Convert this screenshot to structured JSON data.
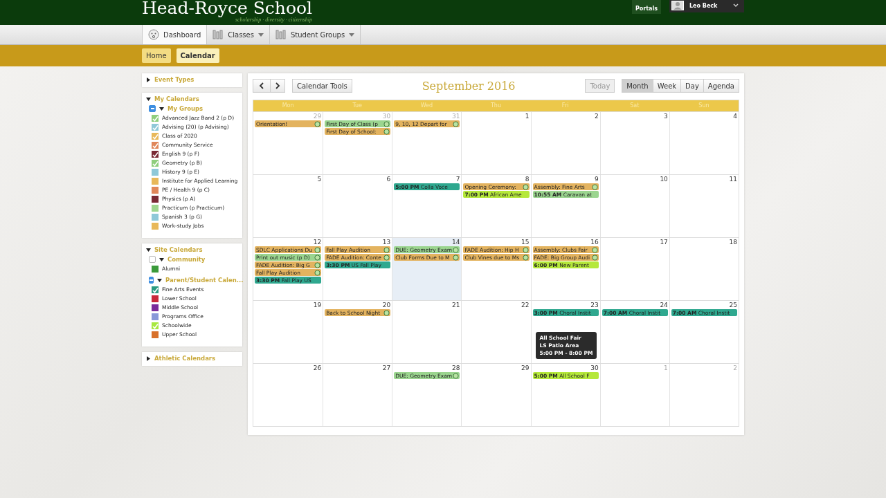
{
  "header": {
    "logo": "Head-Royce School",
    "tagline": "scholarship · diversity · citizenship",
    "portals": "Portals",
    "user": "Leo Beck"
  },
  "nav": [
    {
      "label": "Dashboard",
      "kind": "dashboard",
      "selected": true,
      "menu": false
    },
    {
      "label": "Classes",
      "kind": "list",
      "selected": false,
      "menu": true
    },
    {
      "label": "Student Groups",
      "kind": "list",
      "selected": false,
      "menu": true
    }
  ],
  "breadcrumbs": [
    {
      "label": "Home",
      "selected": false
    },
    {
      "label": "Calendar",
      "selected": true
    }
  ],
  "sidebar": [
    {
      "title": "Event Types",
      "expanded": false
    },
    {
      "title": "My Calendars",
      "expanded": true,
      "groups": [
        {
          "title": "My Groups",
          "checked": true,
          "expanded": true,
          "items": [
            {
              "label": "Advanced Jazz Band 2 (p D)",
              "color": "#8fce7d",
              "checked": true
            },
            {
              "label": "Advising (20) (p Advising)",
              "color": "#8fc8d8",
              "checked": true
            },
            {
              "label": "Class of 2020",
              "color": "#e8b85a",
              "checked": true
            },
            {
              "label": "Community Service",
              "color": "#e0875a",
              "checked": true
            },
            {
              "label": "English 9 (p F)",
              "color": "#7a2a35",
              "checked": true
            },
            {
              "label": "Geometry (p B)",
              "color": "#8fce7d",
              "checked": true
            },
            {
              "label": "History 9 (p E)",
              "color": "#8fc8d8",
              "checked": false
            },
            {
              "label": "Institute for Applied Learning",
              "color": "#e8b85a",
              "checked": false
            },
            {
              "label": "PE / Health 9 (p C)",
              "color": "#e0875a",
              "checked": false
            },
            {
              "label": "Physics (p A)",
              "color": "#7a2a35",
              "checked": false
            },
            {
              "label": "Practicum (p Practicum)",
              "color": "#9fd68f",
              "checked": false
            },
            {
              "label": "Spanish 3 (p G)",
              "color": "#8fc8d8",
              "checked": false
            },
            {
              "label": "Work-study Jobs",
              "color": "#e8b85a",
              "checked": false
            }
          ]
        }
      ]
    },
    {
      "title": "Site Calendars",
      "expanded": true,
      "groups": [
        {
          "title": "Community",
          "checked": false,
          "expanded": true,
          "items": [
            {
              "label": "Alumni",
              "color": "#3a9a3a",
              "checked": false
            }
          ]
        },
        {
          "title": "Parent/Student Calen...",
          "checked": true,
          "expanded": true,
          "items": [
            {
              "label": "Fine Arts Events",
              "color": "#2a9a80",
              "checked": true
            },
            {
              "label": "Lower School",
              "color": "#c8283a",
              "checked": false
            },
            {
              "label": "Middle School",
              "color": "#7a2a9a",
              "checked": false
            },
            {
              "label": "Programs Office",
              "color": "#8898d8",
              "checked": false
            },
            {
              "label": "Schoolwide",
              "color": "#a8e840",
              "checked": true
            },
            {
              "label": "Upper School",
              "color": "#d8702a",
              "checked": false
            }
          ]
        }
      ]
    },
    {
      "title": "Athletic Calendars",
      "expanded": false
    }
  ],
  "calendar": {
    "tools": "Calendar Tools",
    "title": "September 2016",
    "today": {
      "label": "Today",
      "disabled": true
    },
    "views": [
      {
        "label": "Month",
        "selected": true
      },
      {
        "label": "Week",
        "selected": false
      },
      {
        "label": "Day",
        "selected": false
      },
      {
        "label": "Agenda",
        "selected": false
      }
    ],
    "weekdays": [
      "Mon",
      "Tue",
      "Wed",
      "Thu",
      "Fri",
      "Sat",
      "Sun"
    ],
    "weeks": [
      [
        {
          "day": "29",
          "other_month": true,
          "today": false,
          "events": [
            {
              "title": "Orientation!",
              "color": "#e3b35f"
            }
          ]
        },
        {
          "day": "30",
          "other_month": true,
          "today": false,
          "events": [
            {
              "title": "First Day of Class (p",
              "color": "#9bd58f"
            },
            {
              "title": "First Day of School:",
              "color": "#e3b35f"
            }
          ]
        },
        {
          "day": "31",
          "other_month": true,
          "today": false,
          "events": [
            {
              "title": "9, 10, 12 Depart for",
              "color": "#e3b35f"
            }
          ]
        },
        {
          "day": "1",
          "other_month": false,
          "today": false
        },
        {
          "day": "2",
          "other_month": false,
          "today": false
        },
        {
          "day": "3",
          "other_month": false,
          "today": false
        },
        {
          "day": "4",
          "other_month": false,
          "today": false
        }
      ],
      [
        {
          "day": "5",
          "other_month": false,
          "today": false
        },
        {
          "day": "6",
          "other_month": false,
          "today": false
        },
        {
          "day": "7",
          "other_month": false,
          "today": false,
          "events": [
            {
              "time": "5:00 PM",
              "title": "Colla Voce",
              "color": "#2fa88f"
            }
          ]
        },
        {
          "day": "8",
          "other_month": false,
          "today": false,
          "events": [
            {
              "title": "Opening Ceremony:",
              "color": "#e3b35f"
            },
            {
              "time": "7:00 PM",
              "title": "African Ame",
              "color": "#b5e83a"
            }
          ]
        },
        {
          "day": "9",
          "other_month": false,
          "today": false,
          "events": [
            {
              "title": "Assembly: Fine Arts",
              "color": "#e3b35f"
            },
            {
              "time": "10:55 AM",
              "title": "Caravan at",
              "color": "#9bd58f"
            }
          ]
        },
        {
          "day": "10",
          "other_month": false,
          "today": false
        },
        {
          "day": "11",
          "other_month": false,
          "today": false
        }
      ],
      [
        {
          "day": "12",
          "other_month": false,
          "today": false,
          "events": [
            {
              "title": "SDLC Applications Du",
              "color": "#e3b35f"
            },
            {
              "title": "Print out music (p D)",
              "color": "#9bd58f"
            },
            {
              "title": "FADE Audition: Big G",
              "color": "#e3b35f"
            },
            {
              "title": "Fall Play Audition",
              "color": "#e3b35f"
            },
            {
              "time": "3:30 PM",
              "title": "Fall Play US",
              "color": "#2fa88f"
            }
          ]
        },
        {
          "day": "13",
          "other_month": false,
          "today": false,
          "events": [
            {
              "title": "Fall Play Audition",
              "color": "#e3b35f"
            },
            {
              "title": "FADE Audition: Conte",
              "color": "#e3b35f"
            },
            {
              "time": "3:30 PM",
              "title": "US Fall Play",
              "color": "#2fa88f"
            }
          ]
        },
        {
          "day": "14",
          "other_month": false,
          "today": true,
          "events": [
            {
              "title": "DUE: Geometry Exam",
              "color": "#9bd58f"
            },
            {
              "title": "Club Forms Due to M",
              "color": "#e3b35f"
            }
          ]
        },
        {
          "day": "15",
          "other_month": false,
          "today": false,
          "events": [
            {
              "title": "FADE Audition: Hip H",
              "color": "#e3b35f"
            },
            {
              "title": "Club Vines due to Ms",
              "color": "#e3b35f"
            }
          ]
        },
        {
          "day": "16",
          "other_month": false,
          "today": false,
          "events": [
            {
              "title": "Assembly: Clubs Fair",
              "color": "#e3b35f"
            },
            {
              "title": "FADE: Big Group Audi",
              "color": "#e3b35f"
            },
            {
              "time": "6:00 PM",
              "title": "New Parent",
              "color": "#b5e83a"
            }
          ]
        },
        {
          "day": "17",
          "other_month": false,
          "today": false
        },
        {
          "day": "18",
          "other_month": false,
          "today": false
        }
      ],
      [
        {
          "day": "19",
          "other_month": false,
          "today": false
        },
        {
          "day": "20",
          "other_month": false,
          "today": false,
          "events": [
            {
              "title": "Back to School Night",
              "color": "#e3b35f"
            }
          ]
        },
        {
          "day": "21",
          "other_month": false,
          "today": false
        },
        {
          "day": "22",
          "other_month": false,
          "today": false
        },
        {
          "day": "23",
          "other_month": false,
          "today": false,
          "events": [
            {
              "time": "3:00 PM",
              "title": "Choral Instit",
              "color": "#2fa88f"
            }
          ]
        },
        {
          "day": "24",
          "other_month": false,
          "today": false,
          "events": [
            {
              "time": "7:00 AM",
              "title": "Choral Instit",
              "color": "#2fa88f"
            }
          ]
        },
        {
          "day": "25",
          "other_month": false,
          "today": false,
          "events": [
            {
              "time": "7:00 AM",
              "title": "Choral Instit",
              "color": "#2fa88f"
            }
          ]
        }
      ],
      [
        {
          "day": "26",
          "other_month": false,
          "today": false
        },
        {
          "day": "27",
          "other_month": false,
          "today": false
        },
        {
          "day": "28",
          "other_month": false,
          "today": false,
          "events": [
            {
              "title": "DUE: Geometry Exam",
              "color": "#9bd58f"
            }
          ]
        },
        {
          "day": "29",
          "other_month": false,
          "today": false
        },
        {
          "day": "30",
          "other_month": false,
          "today": false,
          "tooltip": [
            "All School Fair",
            "LS Patio Area",
            "5:00 PM - 8:00 PM"
          ],
          "events": [
            {
              "time": "5:00 PM",
              "title": "All School F",
              "color": "#b5e83a"
            }
          ]
        },
        {
          "day": "1",
          "other_month": true,
          "today": false
        },
        {
          "day": "2",
          "other_month": true,
          "today": false
        }
      ]
    ]
  }
}
